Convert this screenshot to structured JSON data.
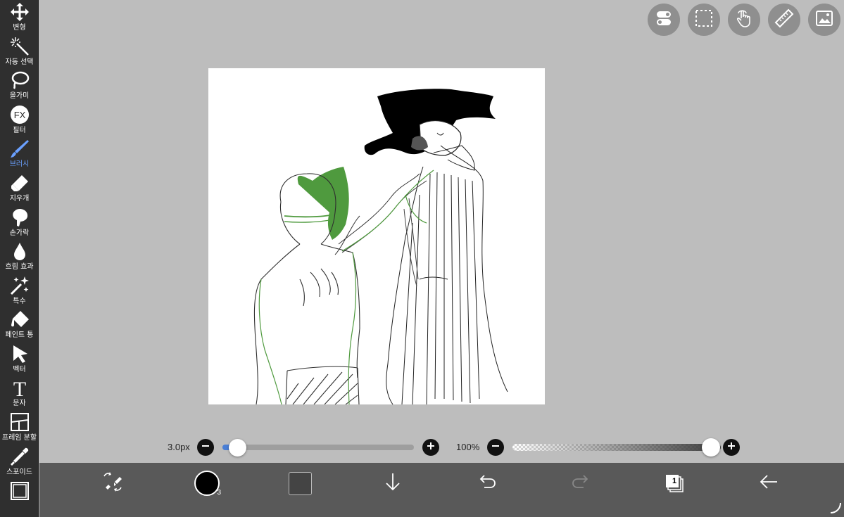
{
  "toolbar": {
    "tools": [
      {
        "label": "변형",
        "icon": "move-icon"
      },
      {
        "label": "자동 선택",
        "icon": "magic-wand-icon"
      },
      {
        "label": "올가미",
        "icon": "lasso-icon"
      },
      {
        "label": "필터",
        "icon": "fx-filter-icon",
        "icon_text": "FX"
      },
      {
        "label": "브러시",
        "icon": "brush-icon",
        "active": true
      },
      {
        "label": "지우개",
        "icon": "eraser-icon"
      },
      {
        "label": "손가락",
        "icon": "smudge-finger-icon"
      },
      {
        "label": "흐림 효과",
        "icon": "blur-drop-icon"
      },
      {
        "label": "특수",
        "icon": "sparkle-special-icon"
      },
      {
        "label": "페인트 통",
        "icon": "paint-bucket-icon"
      },
      {
        "label": "벡터",
        "icon": "vector-arrow-icon"
      },
      {
        "label": "문자",
        "icon": "text-icon",
        "icon_text": "T"
      },
      {
        "label": "프레임 분할",
        "icon": "frame-divider-icon"
      },
      {
        "label": "스포이드",
        "icon": "eyedropper-icon"
      },
      {
        "label": "",
        "icon": "canvas-frame-icon"
      }
    ]
  },
  "top_buttons": [
    "toggle-icon",
    "selection-icon",
    "touch-icon",
    "ruler-icon",
    "image-icon"
  ],
  "brush_size": {
    "label": "3.0px",
    "value_fraction": 0.06
  },
  "opacity": {
    "label": "100%",
    "value_fraction": 1.0
  },
  "bottom_bar": {
    "color_badge": "3",
    "layer_count": "1",
    "items": [
      "swap-tools-icon",
      "color-swatch",
      "secondary-swatch",
      "download-icon",
      "undo-icon",
      "redo-icon",
      "layers-icon",
      "back-icon"
    ]
  },
  "colors": {
    "toolbar_bg": "#2f2f2f",
    "workspace_bg": "#bdbdbd",
    "bottom_bar_bg": "#595959",
    "accent": "#4a7fd6",
    "active_label": "#6aa0ff"
  }
}
